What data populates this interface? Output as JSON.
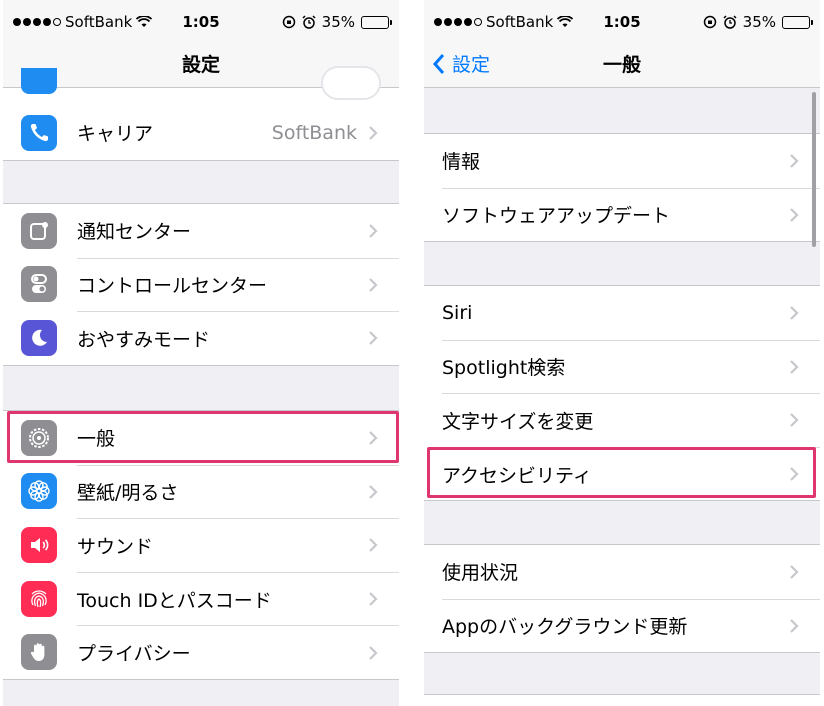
{
  "left_screen": {
    "status": {
      "carrier": "SoftBank",
      "time": "1:05",
      "battery": "35%",
      "battery_level": 0.35
    },
    "nav_title": "設定",
    "group1": [
      {
        "label": "キャリア",
        "value": "SoftBank",
        "icon": "phone-icon",
        "color": "#1e8cf0"
      }
    ],
    "group2": [
      {
        "label": "通知センター",
        "icon": "notification-center-icon",
        "color": "#8e8e93"
      },
      {
        "label": "コントロールセンター",
        "icon": "control-center-icon",
        "color": "#8e8e93"
      },
      {
        "label": "おやすみモード",
        "icon": "moon-icon",
        "color": "#5856d6"
      }
    ],
    "group3": [
      {
        "label": "一般",
        "icon": "gear-icon",
        "color": "#8e8e93",
        "highlighted": true
      },
      {
        "label": "壁紙/明るさ",
        "icon": "wallpaper-icon",
        "color": "#1e8cf0"
      },
      {
        "label": "サウンド",
        "icon": "sound-icon",
        "color": "#ff2d55"
      },
      {
        "label": "Touch IDとパスコード",
        "icon": "fingerprint-icon",
        "color": "#ff2d55"
      },
      {
        "label": "プライバシー",
        "icon": "hand-icon",
        "color": "#8e8e93"
      }
    ]
  },
  "right_screen": {
    "status": {
      "carrier": "SoftBank",
      "time": "1:05",
      "battery": "35%",
      "battery_level": 0.35
    },
    "nav_back": "設定",
    "nav_title": "一般",
    "group1": [
      {
        "label": "情報"
      },
      {
        "label": "ソフトウェアアップデート"
      }
    ],
    "group2": [
      {
        "label": "Siri"
      },
      {
        "label": "Spotlight検索"
      },
      {
        "label": "文字サイズを変更"
      },
      {
        "label": "アクセシビリティ",
        "highlighted": true
      }
    ],
    "group3": [
      {
        "label": "使用状況"
      },
      {
        "label": "Appのバックグラウンド更新"
      }
    ]
  },
  "colors": {
    "accent": "#007aff",
    "highlight": "#e0366f",
    "separator": "#c8c7cc",
    "background": "#efeff4"
  }
}
